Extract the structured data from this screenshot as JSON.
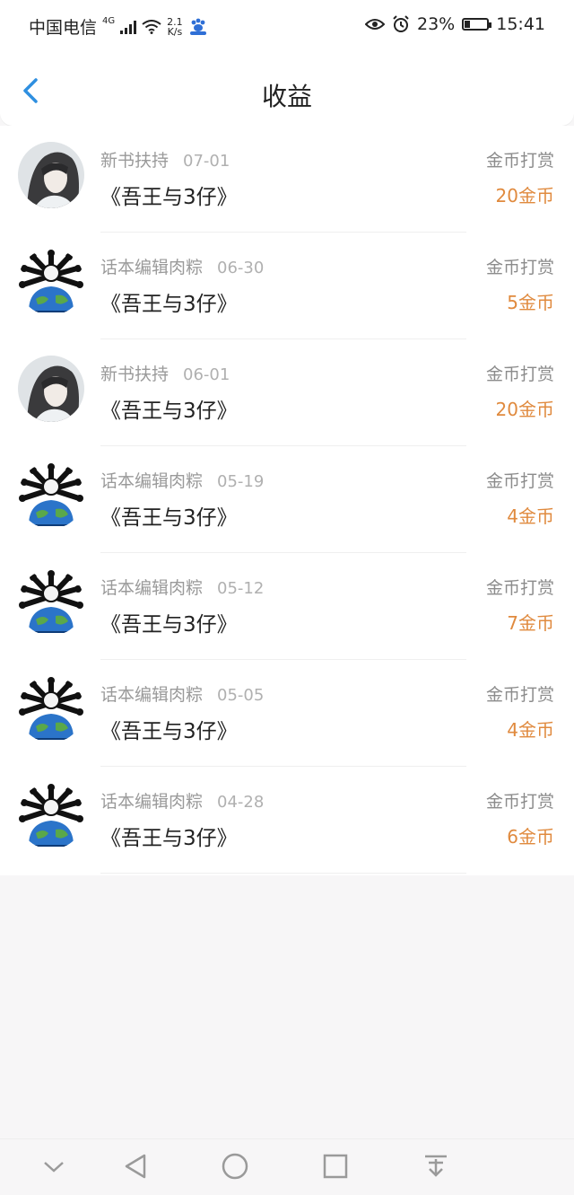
{
  "status": {
    "carrier": "中国电信",
    "network": "4G",
    "speed_value": "2.1",
    "speed_unit": "K/s",
    "battery": "23%",
    "time": "15:41",
    "battery_level": 0.23
  },
  "header": {
    "title": "收益",
    "back_icon": "chevron-left-icon"
  },
  "colors": {
    "accent": "#2f8fe0",
    "amount": "#e08a3e"
  },
  "items": [
    {
      "source": "新书扶持",
      "date": "07-01",
      "book": "《吾王与3仔》",
      "type": "金币打赏",
      "amount": "20金币",
      "avatar": "portrait"
    },
    {
      "source": "话本编辑肉粽",
      "date": "06-30",
      "book": "《吾王与3仔》",
      "type": "金币打赏",
      "amount": "5金币",
      "avatar": "globe"
    },
    {
      "source": "新书扶持",
      "date": "06-01",
      "book": "《吾王与3仔》",
      "type": "金币打赏",
      "amount": "20金币",
      "avatar": "portrait"
    },
    {
      "source": "话本编辑肉粽",
      "date": "05-19",
      "book": "《吾王与3仔》",
      "type": "金币打赏",
      "amount": "4金币",
      "avatar": "globe"
    },
    {
      "source": "话本编辑肉粽",
      "date": "05-12",
      "book": "《吾王与3仔》",
      "type": "金币打赏",
      "amount": "7金币",
      "avatar": "globe"
    },
    {
      "source": "话本编辑肉粽",
      "date": "05-05",
      "book": "《吾王与3仔》",
      "type": "金币打赏",
      "amount": "4金币",
      "avatar": "globe"
    },
    {
      "source": "话本编辑肉粽",
      "date": "04-28",
      "book": "《吾王与3仔》",
      "type": "金币打赏",
      "amount": "6金币",
      "avatar": "globe"
    }
  ],
  "navbar": [
    "chevron-down-icon",
    "back-triangle-icon",
    "home-circle-icon",
    "recents-square-icon",
    "download-arrow-icon"
  ]
}
